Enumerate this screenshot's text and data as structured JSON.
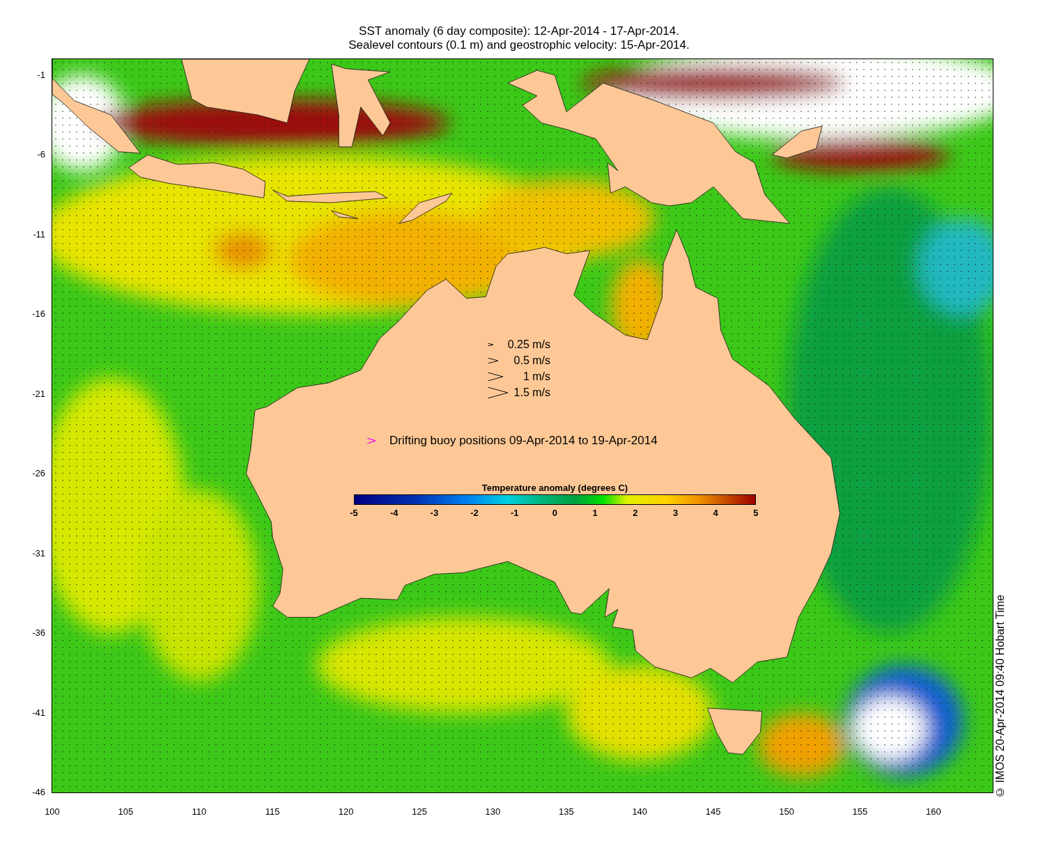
{
  "title": [
    "SST anomaly (6 day composite): 12-Apr-2014 - 17-Apr-2014.",
    "Sealevel contours (0.1 m) and geostrophic velocity: 15-Apr-2014."
  ],
  "map": {
    "y_axis_labels": [
      "-1",
      "-6",
      "-11",
      "-16",
      "-21",
      "-26",
      "-31",
      "-36",
      "-41",
      "-46"
    ],
    "x_axis_labels": [
      "100",
      "105",
      "110",
      "115",
      "120",
      "125",
      "130",
      "135",
      "140",
      "145",
      "150",
      "155",
      "160"
    ]
  },
  "velocity_legend": [
    {
      "label": "0.25 m/s"
    },
    {
      "label": "0.5 m/s"
    },
    {
      "label": "1 m/s"
    },
    {
      "label": "1.5 m/s"
    }
  ],
  "buoy_legend": {
    "label": "Drifting buoy positions 09-Apr-2014 to 19-Apr-2014"
  },
  "colorbar": {
    "title": "Temperature anomaly (degrees C)",
    "ticks": [
      "-5",
      "-4",
      "-3",
      "-2",
      "-1",
      "0",
      "1",
      "2",
      "3",
      "4",
      "5"
    ]
  },
  "credit": "© IMOS 20-Apr-2014 09:40 Hobart Time"
}
